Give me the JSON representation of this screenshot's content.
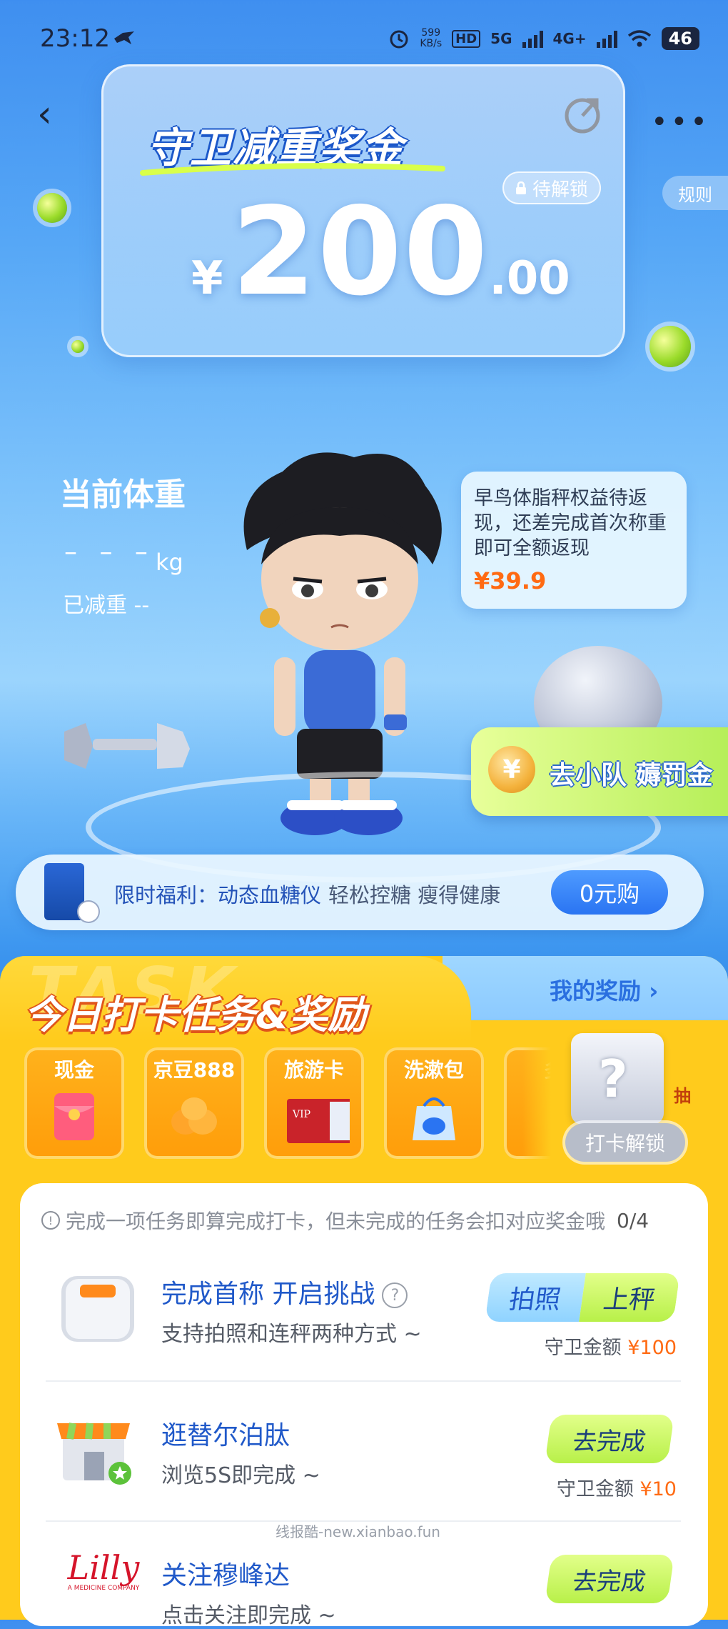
{
  "status_bar": {
    "time": "23:12",
    "net_speed_value": "599",
    "net_speed_unit": "KB/s",
    "hd": "HD",
    "net1": "5G",
    "net2": "4G+",
    "battery": "46"
  },
  "header": {
    "bonus_title": "守卫减重奖金",
    "lock_label": "待解锁",
    "amount_currency": "¥",
    "amount_int": "200",
    "amount_dec": ".00",
    "rules": "规则"
  },
  "weight": {
    "label": "当前体重",
    "value": "– – –",
    "unit": "kg",
    "lost": "已减重 --"
  },
  "bubble": {
    "text": "早鸟体脂秤权益待返现，还差完成首次称重即可全额返现",
    "price": "¥39.9"
  },
  "team": {
    "coin": "¥",
    "label": "去小队 薅罚金"
  },
  "promo": {
    "text": "限时福利：动态血糖仪",
    "sub": "轻松控糖 瘦得健康",
    "button": "0元购"
  },
  "tasks": {
    "watermark": "TASK",
    "title": "今日打卡任务&奖励",
    "my_rewards": "我的奖励 ›",
    "rewards": [
      {
        "label": "现金",
        "icon": "red-envelope-icon"
      },
      {
        "label": "京豆888",
        "icon": "beans-icon"
      },
      {
        "label": "旅游卡",
        "icon": "vip-card-icon"
      },
      {
        "label": "洗漱包",
        "icon": "toiletry-bag-icon"
      },
      {
        "label": "多",
        "icon": "more-icon"
      }
    ],
    "mystery": {
      "q": "?",
      "tag": "抽",
      "button": "打卡解锁"
    },
    "notice": "完成一项任务即算完成打卡，但未完成的任务会扣对应奖金哦",
    "progress": "0/4",
    "items": [
      {
        "title": "完成首称 开启挑战",
        "sub": "支持拍照和连秤两种方式 ~",
        "btn_a": "拍照",
        "btn_b": "上秤",
        "reward_label": "守卫金额",
        "reward_value": "¥100"
      },
      {
        "title": "逛替尔泊肽",
        "sub": "浏览5S即完成 ~",
        "button": "去完成",
        "reward_label": "守卫金额",
        "reward_value": "¥10"
      },
      {
        "title": "关注穆峰达",
        "sub": "点击关注即完成 ~",
        "button": "去完成",
        "brand_logo": "Lilly",
        "brand_sub": "A MEDICINE COMPANY"
      }
    ]
  },
  "watermark": "线报酷-new.xianbao.fun",
  "colors": {
    "accent_blue": "#2059c9",
    "orange": "#ff6a12",
    "yellow": "#ffcb1c",
    "green": "#b8f049"
  }
}
